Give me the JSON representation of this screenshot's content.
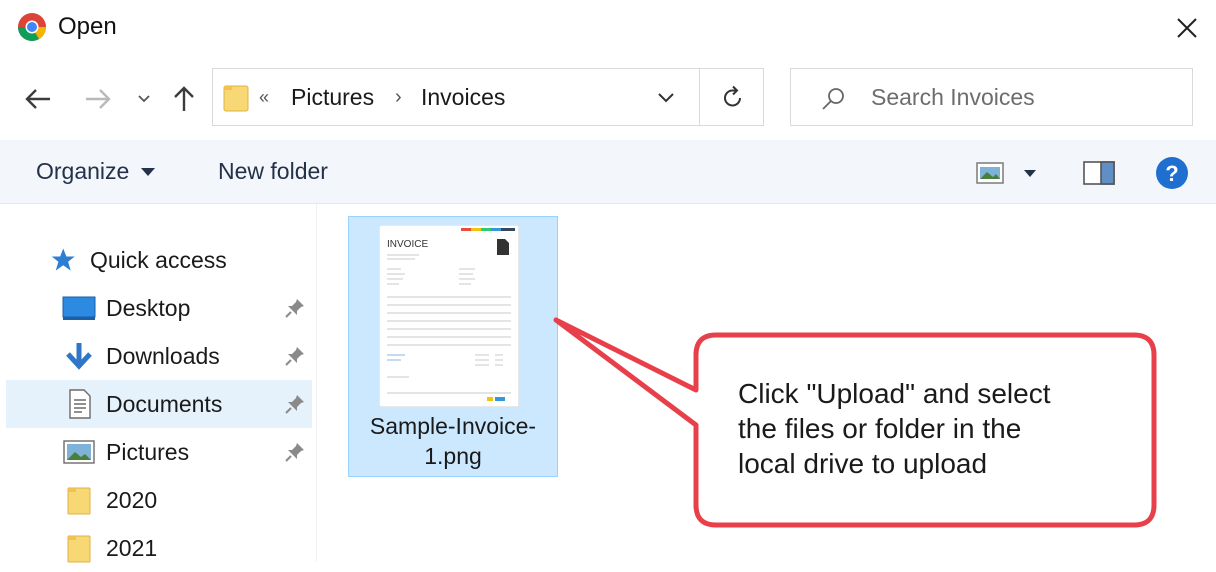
{
  "window": {
    "title": "Open",
    "app_icon": "chrome-logo",
    "close_icon": "close-icon"
  },
  "navigation": {
    "back_icon": "arrow-left-icon",
    "forward_icon": "arrow-right-icon",
    "recent_icon": "chevron-down-icon",
    "up_icon": "arrow-up-icon"
  },
  "address": {
    "overflow": "«",
    "crumbs": [
      "Pictures",
      "Invoices"
    ],
    "separator": "›",
    "dropdown_icon": "chevron-down-icon",
    "refresh_icon": "refresh-icon"
  },
  "search": {
    "placeholder": "Search Invoices",
    "icon": "search-icon"
  },
  "toolbar": {
    "organize": "Organize",
    "new_folder": "New folder",
    "view_icon": "view-options-icon",
    "preview_icon": "preview-pane-icon",
    "help": "?"
  },
  "nav_pane": {
    "quick_access": "Quick access",
    "items": [
      {
        "label": "Desktop",
        "icon": "desktop-icon",
        "pinned": true
      },
      {
        "label": "Downloads",
        "icon": "download-icon",
        "pinned": true
      },
      {
        "label": "Documents",
        "icon": "document-icon",
        "pinned": true,
        "selected": true
      },
      {
        "label": "Pictures",
        "icon": "pictures-icon",
        "pinned": true
      },
      {
        "label": "2020",
        "icon": "folder-icon",
        "pinned": false
      },
      {
        "label": "2021",
        "icon": "folder-icon",
        "pinned": false
      }
    ]
  },
  "files": [
    {
      "name": "Sample-Invoice-\n1.png",
      "thumbnail_heading": "INVOICE",
      "selected": true
    }
  ],
  "callout": {
    "text": "Click \"Upload\" and select\nthe files or folder in the\nlocal drive to upload"
  },
  "colors": {
    "selection": "#cce8ff",
    "nav_selection": "#e5f1fb",
    "toolbar_bg": "#f3f6fa",
    "callout_border": "#e8404a",
    "help_blue": "#1e6fd0"
  }
}
